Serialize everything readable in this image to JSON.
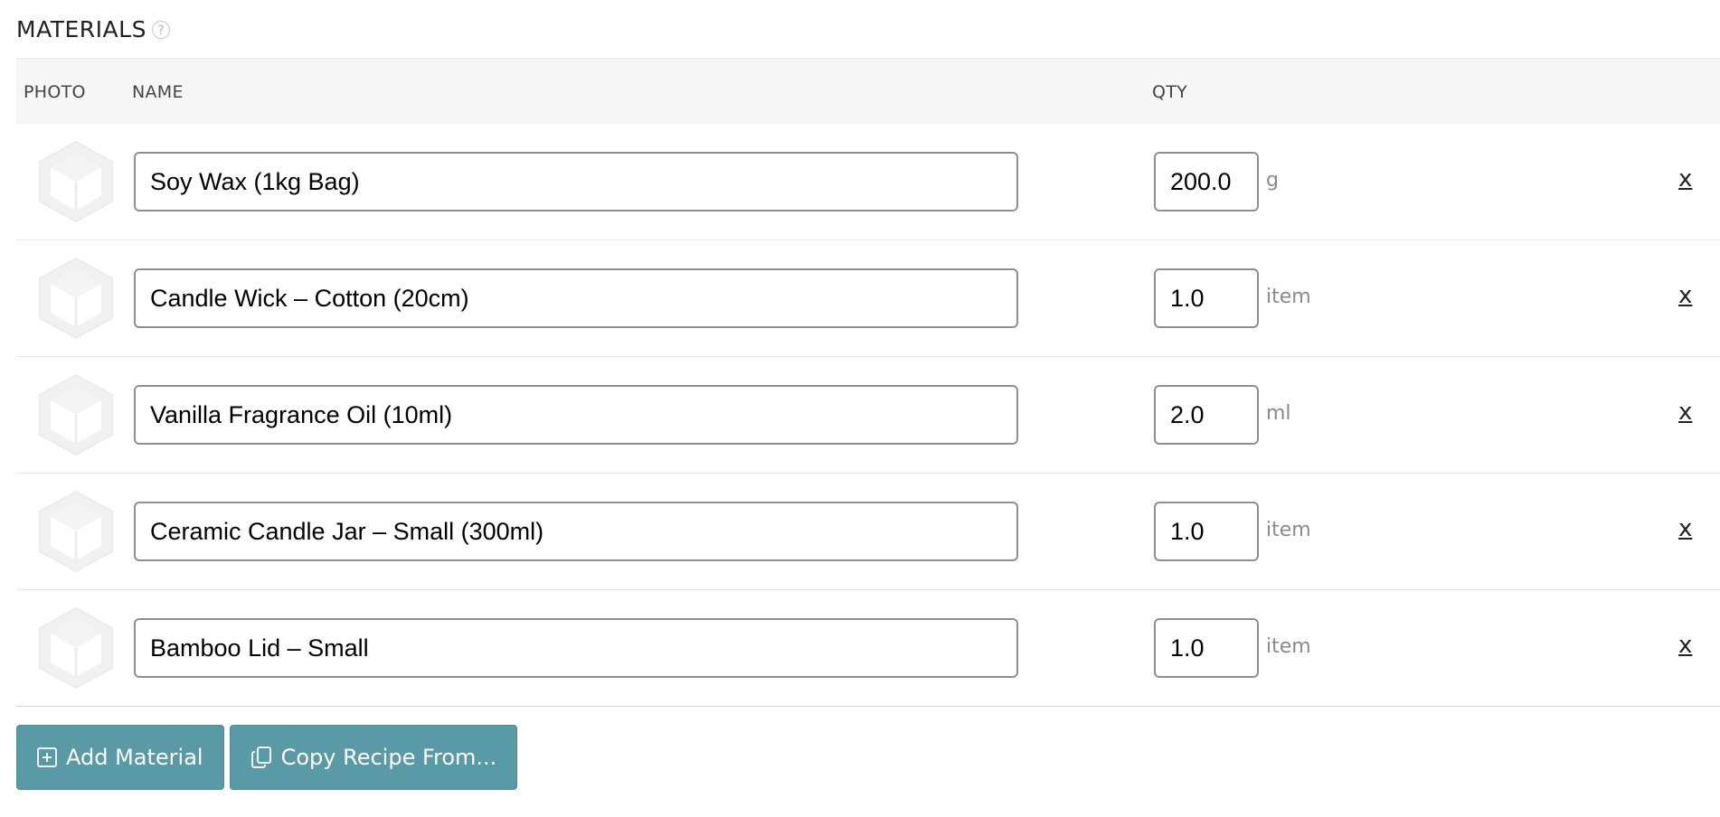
{
  "section": {
    "title": "MATERIALS",
    "help_icon": "help-circle-icon"
  },
  "table": {
    "headers": {
      "photo": "PHOTO",
      "name": "NAME",
      "qty": "QTY"
    },
    "rows": [
      {
        "name": "Soy Wax (1kg Bag)",
        "qty": "200.0",
        "unit": "g",
        "remove": "x"
      },
      {
        "name": "Candle Wick – Cotton (20cm)",
        "qty": "1.0",
        "unit": "item",
        "remove": "x"
      },
      {
        "name": "Vanilla Fragrance Oil (10ml)",
        "qty": "2.0",
        "unit": "ml",
        "remove": "x"
      },
      {
        "name": "Ceramic Candle Jar – Small (300ml)",
        "qty": "1.0",
        "unit": "item",
        "remove": "x"
      },
      {
        "name": "Bamboo Lid – Small",
        "qty": "1.0",
        "unit": "item",
        "remove": "x"
      }
    ]
  },
  "buttons": {
    "add_material": "Add Material",
    "copy_recipe": "Copy Recipe From..."
  },
  "colors": {
    "button_bg": "#5a9aa6",
    "header_bg": "#f6f6f6",
    "placeholder_icon": "#f0f0f0"
  }
}
